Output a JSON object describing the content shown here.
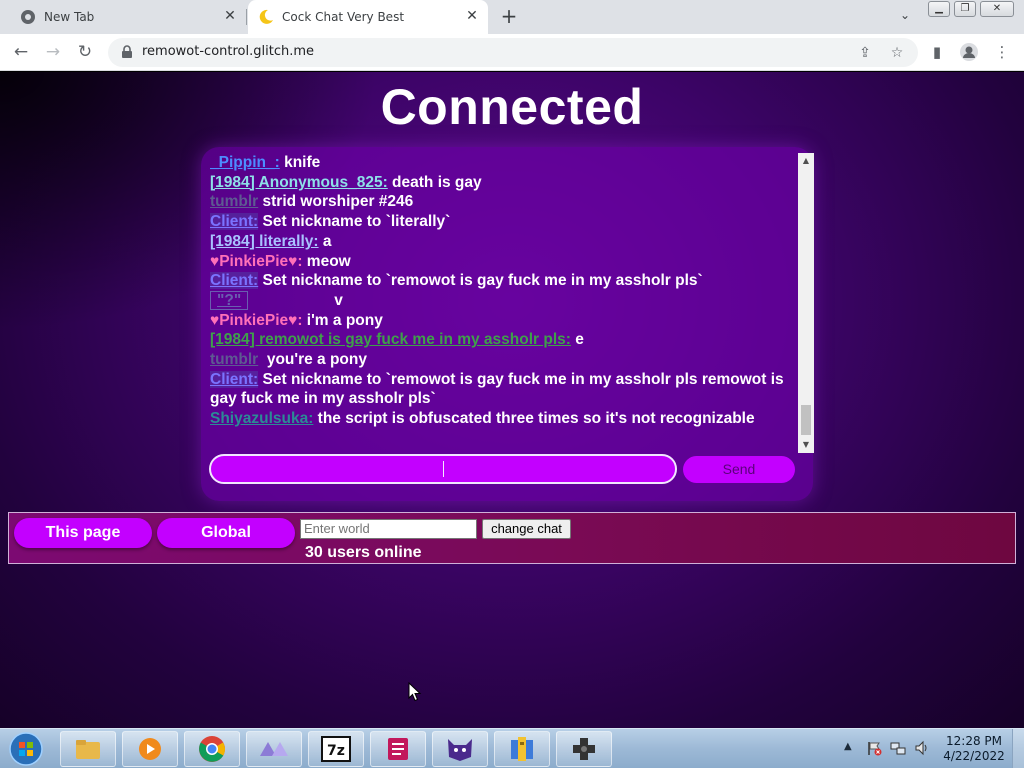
{
  "browser": {
    "tabs": [
      {
        "title": "New Tab",
        "icon": "chrome-icon"
      },
      {
        "title": "Cock Chat Very Best",
        "icon": "moon-icon",
        "active": true
      }
    ],
    "url": "remowot-control.glitch.me"
  },
  "page": {
    "status": "Connected",
    "messages": [
      {
        "nick": "_Pippin_:",
        "style": "pippin",
        "text": " knife"
      },
      {
        "nick": "[1984] Anonymous_825:",
        "style": "anon",
        "text": " death is gay"
      },
      {
        "nick": "tumblr",
        "style": "tumblr",
        "text": " strid worshiper #246"
      },
      {
        "nick": "Client:",
        "style": "client",
        "text": " Set nickname to `literally`"
      },
      {
        "nick": "[1984] literally:",
        "style": "literally",
        "text": " a"
      },
      {
        "nick": "♥PinkiePie♥:",
        "style": "pinkie",
        "text": " meow"
      },
      {
        "nick": "Client:",
        "style": "client",
        "text": " Set nickname to `remowot is gay fuck me in my assholr pls`"
      },
      {
        "nick": "\"?\"",
        "style": "q",
        "text": "                    v"
      },
      {
        "nick": "♥PinkiePie♥:",
        "style": "pinkie",
        "text": " i'm a pony"
      },
      {
        "nick": "[1984] remowot is gay fuck me in my assholr pls:",
        "style": "remowot",
        "text": " e"
      },
      {
        "nick": "tumblr",
        "style": "tumblr",
        "text": "  you're a pony"
      },
      {
        "nick": "Client:",
        "style": "client",
        "text": " Set nickname to `remowot is gay fuck me in my assholr pls remowot is gay fuck me in my assholr pls`"
      },
      {
        "nick": "Shiyazulsuka:",
        "style": "shiya",
        "text": " the script is obfuscated three times so it's not recognizable"
      }
    ],
    "chat_input": {
      "value": "",
      "placeholder": ""
    },
    "send_label": "Send",
    "this_page_label": "This page",
    "global_label": "Global",
    "world_input": {
      "value": "",
      "placeholder": "Enter world"
    },
    "change_chat_label": "change chat",
    "users_online": "30 users online"
  },
  "taskbar": {
    "apps": [
      "explorer",
      "media-player",
      "chrome",
      "app-triangles",
      "7zip",
      "app-notepad",
      "app-cat",
      "app-archive",
      "app-gamepad"
    ],
    "clock_time": "12:28 PM",
    "clock_date": "4/22/2022"
  }
}
